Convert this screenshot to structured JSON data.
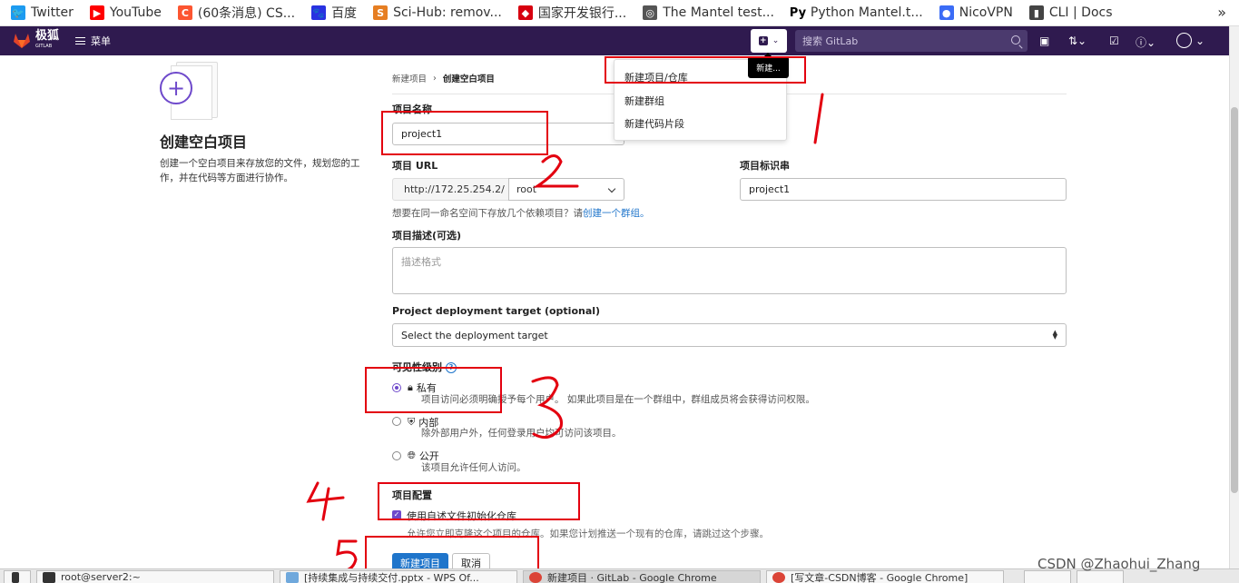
{
  "bookmarks": [
    {
      "label": "Twitter",
      "icon": "twitter-icon",
      "color": "#1d9bf0"
    },
    {
      "label": "YouTube",
      "icon": "youtube-icon",
      "color": "#ff0000"
    },
    {
      "label": "(60条消息) CS...",
      "icon": "csdn-icon",
      "color": "#fc5531"
    },
    {
      "label": "百度",
      "icon": "baidu-icon",
      "color": "#2932e1"
    },
    {
      "label": "Sci-Hub: remov...",
      "icon": "scihub-icon",
      "color": "#e67e22"
    },
    {
      "label": "国家开发银行...",
      "icon": "cdb-icon",
      "color": "#d7000f"
    },
    {
      "label": "The Mantel test...",
      "icon": "globe-icon",
      "color": "#555555"
    },
    {
      "label": "Python Mantel.t...",
      "icon": "py-icon",
      "color": "#000000"
    },
    {
      "label": "NicoVPN",
      "icon": "nicovpn-icon",
      "color": "#3b6cf6"
    },
    {
      "label": "CLI | Docs",
      "icon": "docs-icon",
      "color": "#444444"
    }
  ],
  "header": {
    "logo_text": "极狐",
    "logo_sub": "GITLAB",
    "menu_label": "菜单",
    "search_placeholder": "搜索 GitLab",
    "bg_color": "#2f1a4f"
  },
  "new_menu": {
    "tooltip": "新建...",
    "items": [
      "新建项目/仓库",
      "新建群组",
      "新建代码片段"
    ]
  },
  "intro": {
    "title": "创建空白项目",
    "description": "创建一个空白项目来存放您的文件，规划您的工作，并在代码等方面进行协作。"
  },
  "breadcrumb": {
    "parent": "新建项目",
    "current": "创建空白项目"
  },
  "form": {
    "name_label": "项目名称",
    "name_value": "project1",
    "url_label": "项目 URL",
    "url_prefix": "http://172.25.254.2/",
    "namespace": "root",
    "slug_label": "项目标识串",
    "slug_value": "project1",
    "hint_text": "想要在同一命名空间下存放几个依赖项目？请",
    "hint_link": "创建一个群组。",
    "desc_label": "项目描述(可选)",
    "desc_placeholder": "描述格式",
    "deploy_label": "Project deployment target (optional)",
    "deploy_value": "Select the deployment target",
    "visibility_label": "可见性级别",
    "visibility": [
      {
        "title": "私有",
        "desc": "项目访问必须明确授予每个用户。 如果此项目是在一个群组中，群组成员将会获得访问权限。",
        "selected": true,
        "icon": "lock-icon"
      },
      {
        "title": "内部",
        "desc": "除外部用户外，任何登录用户均可访问该项目。",
        "selected": false,
        "icon": "shield-icon"
      },
      {
        "title": "公开",
        "desc": "该项目允许任何人访问。",
        "selected": false,
        "icon": "globe-icon"
      }
    ],
    "config_label": "项目配置",
    "readme_label": "使用自述文件初始化仓库",
    "readme_desc": "允许您立即克隆这个项目的仓库。如果您计划推送一个现有的仓库，请跳过这个步骤。",
    "submit_label": "新建项目",
    "cancel_label": "取消"
  },
  "annotations": [
    "1",
    "2",
    "3",
    "4",
    "5"
  ],
  "taskbar": [
    {
      "label": "root@server2:~"
    },
    {
      "label": "[持续集成与持续交付.pptx - WPS Of..."
    },
    {
      "label": "新建项目 · GitLab - Google Chrome"
    },
    {
      "label": "[写文章-CSDN博客 - Google Chrome]"
    }
  ],
  "watermark": "CSDN @Zhaohui_Zhang",
  "colors": {
    "accent": "#6e49cb",
    "primary_button": "#1f75cb",
    "annotation_red": "#e3000f"
  }
}
